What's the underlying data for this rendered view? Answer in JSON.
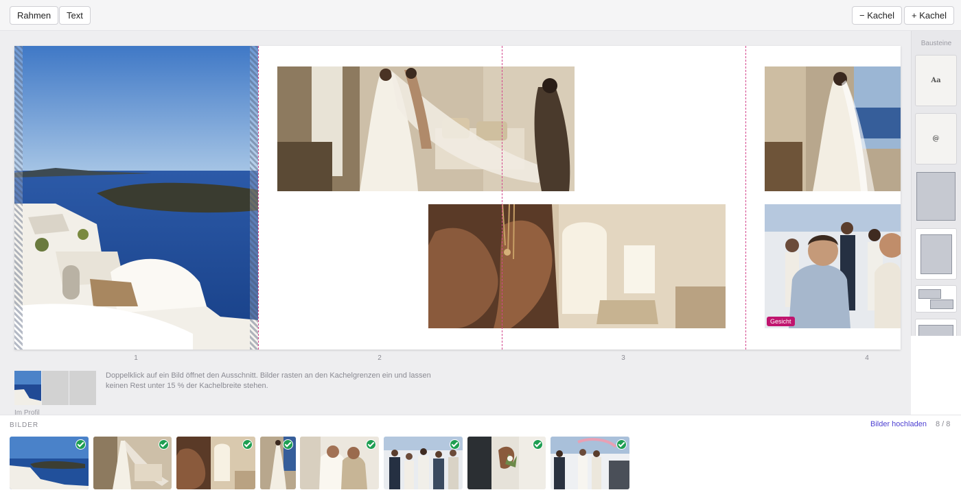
{
  "toolbar": {
    "frame_label": "Rahmen",
    "text_label": "Text",
    "remove_tile_label": "− Kachel",
    "add_tile_label": "+ Kachel"
  },
  "spread": {
    "page_numbers": [
      "1",
      "2",
      "3",
      "4"
    ],
    "face_tag": "Gesicht"
  },
  "hint": {
    "line1": "Doppelklick auf ein Bild öffnet den Ausschnitt. Bilder rasten an den Kachelgrenzen ein und lassen",
    "line2": "keinen Rest unter 15 % der Kachelbreite stehen."
  },
  "preview": {
    "caption": "Im Profil"
  },
  "sidebar": {
    "title": "Bausteine",
    "text_block_glyph": "Aa",
    "at_block_glyph": "@"
  },
  "tray": {
    "title": "BILDER",
    "upload_label": "Bilder hochladen",
    "count": "8 / 8"
  },
  "colors": {
    "accent": "#4b3ed1",
    "guide": "#d4458c",
    "face_tag": "#c0146e",
    "check": "#1e9e52"
  }
}
